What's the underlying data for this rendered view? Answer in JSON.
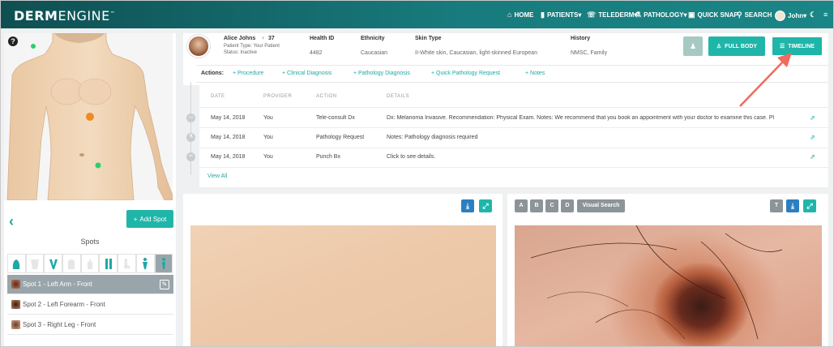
{
  "nav": {
    "logo_bold": "DERM",
    "logo_light": "ENGINE",
    "logo_mark": "™",
    "items": [
      "HOME",
      "PATIENTS▾",
      "TELEDERM▾",
      "PATHOLOGY▾",
      "QUICK SNAP",
      "SEARCH",
      "John▾"
    ]
  },
  "left": {
    "help": "?",
    "add_spot_label": "Add Spot",
    "spots_title": "Spots",
    "spots": [
      {
        "label": "Spot 1 - Left Arm - Front",
        "active": true
      },
      {
        "label": "Spot 2 - Left Forearm - Front",
        "active": false
      },
      {
        "label": "Spot 3 - Right Leg - Front",
        "active": false
      }
    ]
  },
  "patient": {
    "name": "Alice Johns",
    "age": "37",
    "type_line": "Patient Type: Your Patient",
    "status_line": "Status: Inactive",
    "fields": [
      {
        "label": "Health ID",
        "value": "4482"
      },
      {
        "label": "Ethnicity",
        "value": "Caucasian"
      },
      {
        "label": "Skin Type",
        "value": "II-White skin, Caucasian, light-skinned European"
      },
      {
        "label": "History",
        "value": "NMSC, Family"
      }
    ]
  },
  "buttons": {
    "full_body": "FULL BODY",
    "timeline": "TIMELINE"
  },
  "actions": {
    "label": "Actions:",
    "links": [
      "+ Procedure",
      "+ Clinical Diagnosis",
      "+ Pathology Diagnosis",
      "+ Quick Pathology Request",
      "+ Notes"
    ]
  },
  "table": {
    "headers": [
      "DATE",
      "PROVIDER",
      "ACTION",
      "DETAILS"
    ],
    "rows": [
      {
        "date": "May 14, 2018",
        "provider": "You",
        "action": "Tele-consult Dx",
        "details": "Dx: Melanoma Invasive. Recommendation: Physical Exam. Notes: We recommend that you book an appointment with your doctor to examine this case. Pl"
      },
      {
        "date": "May 14, 2018",
        "provider": "You",
        "action": "Pathology Request",
        "details": "Notes: Pathology diagnosis required"
      },
      {
        "date": "May 14, 2018",
        "provider": "You",
        "action": "Punch Bx",
        "details": "Click to see details."
      }
    ],
    "view_all": "View All"
  },
  "viewer": {
    "tabs": [
      "A",
      "B",
      "C",
      "D"
    ],
    "visual_search": "Visual Search"
  },
  "colors": {
    "nav_start": "#0f4f52",
    "nav_end": "#1a8687",
    "teal": "#1fb6a9",
    "link": "#1fa8a4",
    "blue": "#2b7fc1",
    "arrow": "#f06b5d"
  }
}
